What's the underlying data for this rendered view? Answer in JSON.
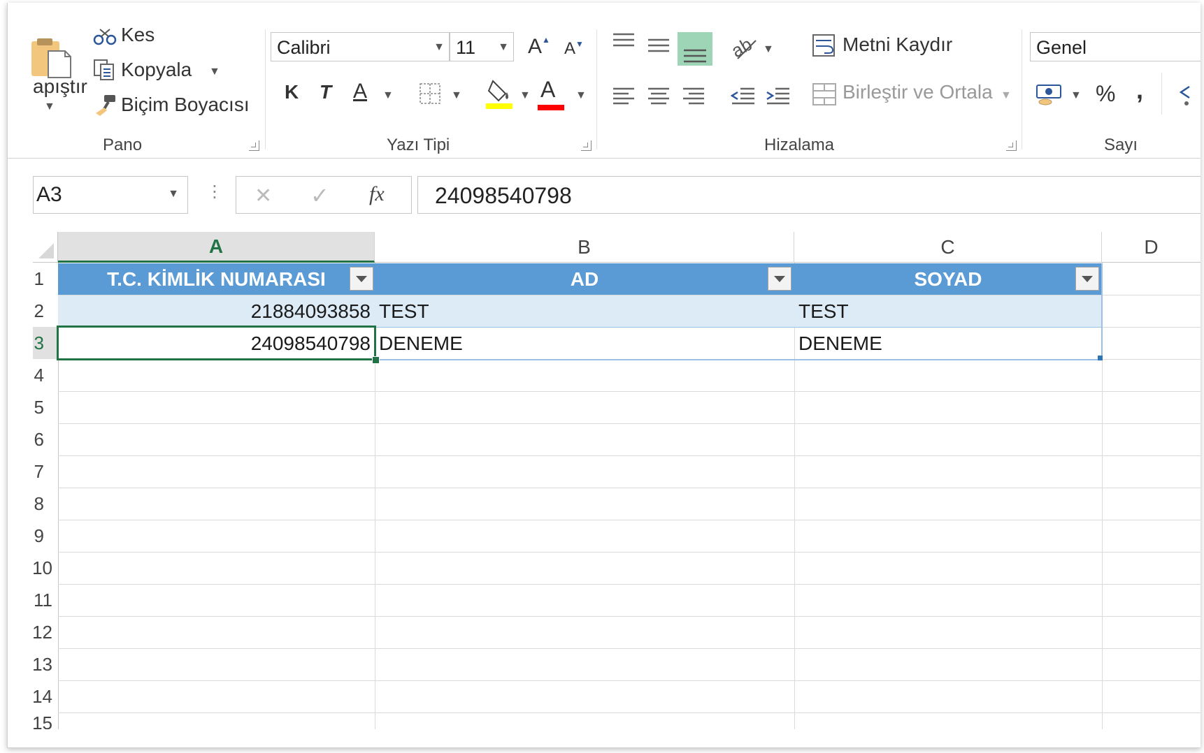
{
  "ribbon": {
    "clipboard": {
      "paste_label": "apıştır",
      "cut_label": "Kes",
      "copy_label": "Kopyala",
      "format_painter_label": "Biçim Boyacısı",
      "group_label": "Pano"
    },
    "font": {
      "font_name": "Calibri",
      "font_size": "11",
      "bold_label": "K",
      "italic_label": "T",
      "underline_label": "A",
      "font_color_label": "A",
      "grow_label": "A",
      "shrink_label": "A",
      "group_label": "Yazı Tipi",
      "highlight_color": "#ffff00",
      "font_color": "#ff0000"
    },
    "alignment": {
      "wrap_text_label": "Metni Kaydır",
      "merge_center_label": "Birleştir ve Ortala",
      "group_label": "Hizalama"
    },
    "number": {
      "format": "Genel",
      "percent_label": "%",
      "comma_label": ",",
      "group_label": "Sayı"
    }
  },
  "formula_bar": {
    "name_box": "A3",
    "fx_label": "fx",
    "content": "24098540798"
  },
  "grid": {
    "columns": [
      "A",
      "B",
      "C",
      "D"
    ],
    "selected_column": "A",
    "row_numbers": [
      "1",
      "2",
      "3",
      "4",
      "5",
      "6",
      "7",
      "8",
      "9",
      "10",
      "11",
      "12",
      "13",
      "14",
      "15"
    ],
    "table_header": [
      "T.C. KİMLİK NUMARASI",
      "AD",
      "SOYAD"
    ],
    "rows": [
      [
        "21884093858",
        "TEST",
        "TEST"
      ],
      [
        "24098540798",
        "DENEME",
        "DENEME"
      ]
    ],
    "colors": {
      "header_fill": "#5b9bd5",
      "band_fill": "#ddebf7",
      "selection": "#217346"
    }
  }
}
